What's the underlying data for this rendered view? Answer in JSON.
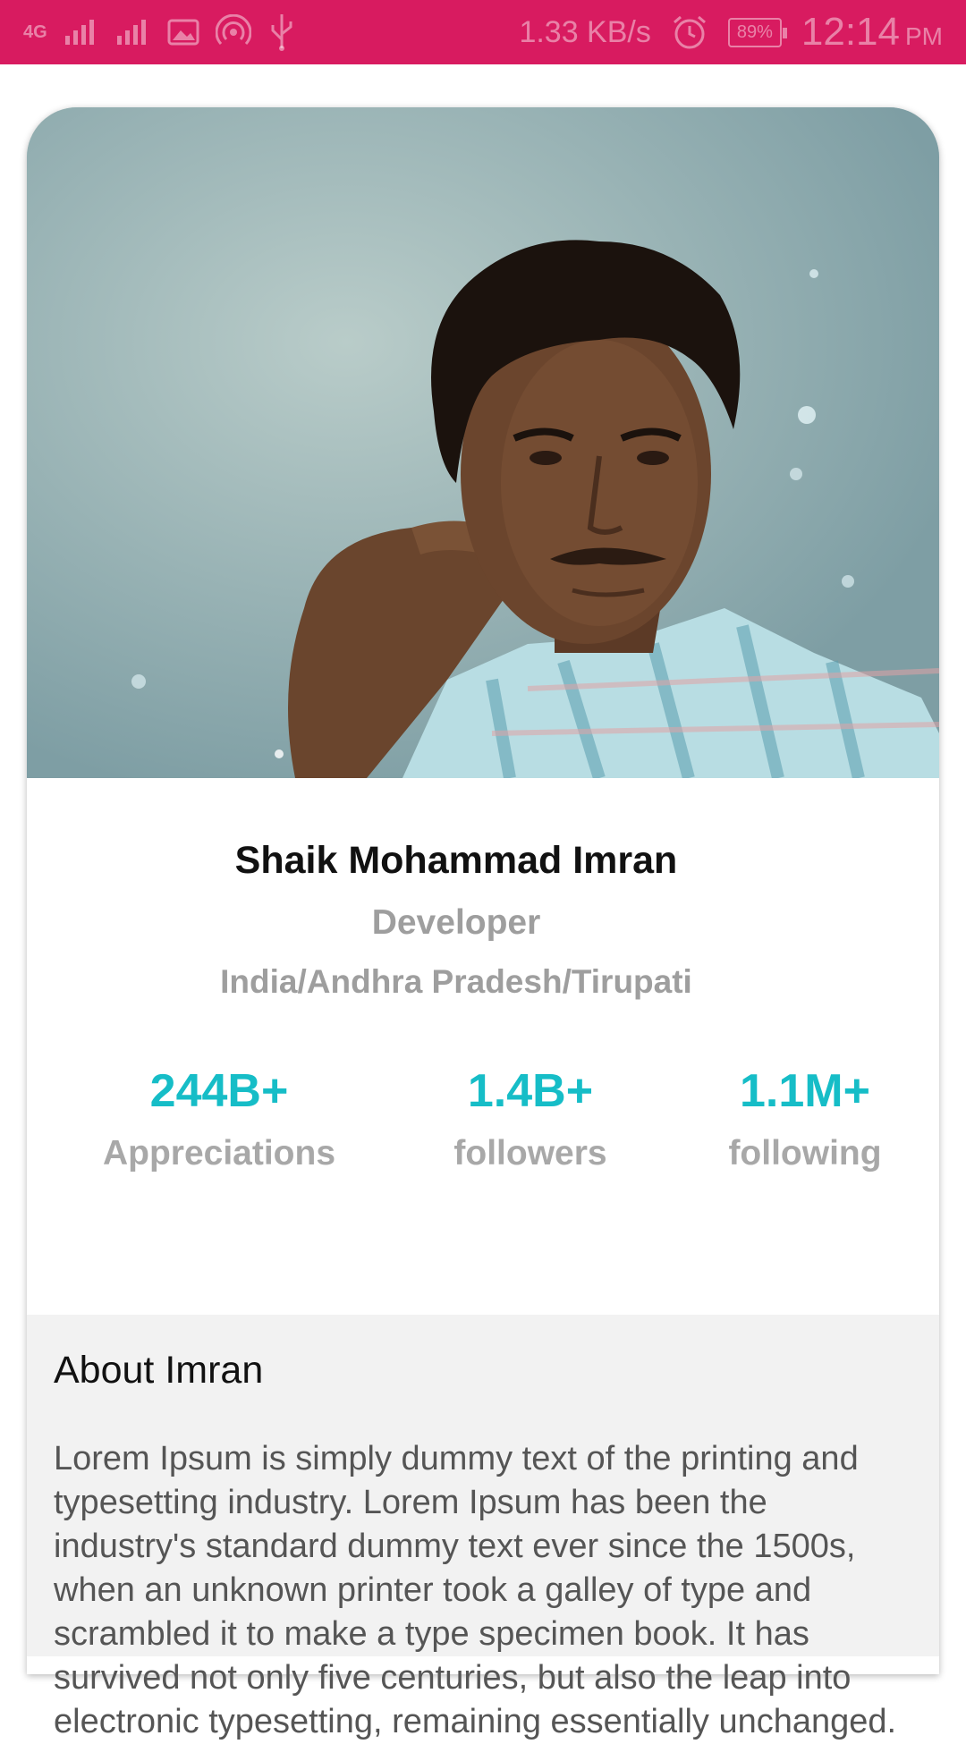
{
  "status_bar": {
    "network": "4G",
    "speed": "1.33 KB/s",
    "battery": "89%",
    "time": "12:14",
    "ampm": "PM",
    "background": "#d81b60"
  },
  "profile": {
    "name": "Shaik Mohammad Imran",
    "role": "Developer",
    "location": "India/Andhra Pradesh/Tirupati",
    "stats": [
      {
        "value": "244B+",
        "label": "Appreciations"
      },
      {
        "value": "1.4B+",
        "label": "followers"
      },
      {
        "value": "1.1M+",
        "label": "following"
      }
    ],
    "accent": "#16bdc7"
  },
  "about": {
    "title": "About Imran",
    "body": "Lorem Ipsum is simply dummy text of the printing and typesetting industry. Lorem Ipsum has been the industry's standard dummy text ever since the 1500s, when an unknown printer took a galley of type and scrambled it to make a type specimen book. It has survived not only five centuries, but also the leap into electronic typesetting, remaining essentially unchanged."
  }
}
